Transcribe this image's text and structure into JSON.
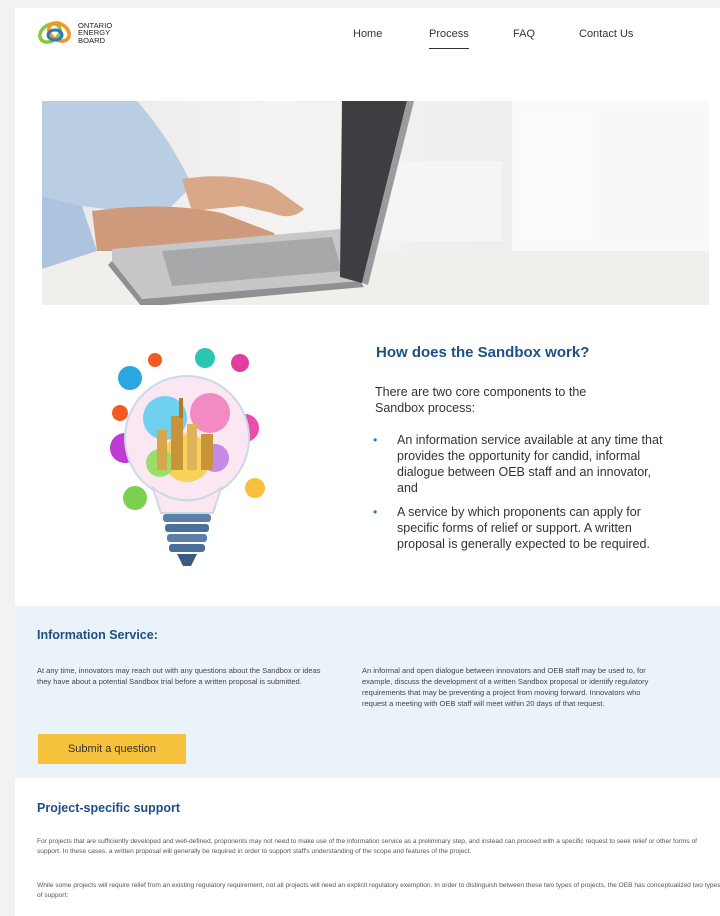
{
  "logo": {
    "lines": [
      "ONTARIO",
      "ENERGY",
      "BOARD"
    ],
    "icon": "oeb-logo-icon",
    "colors": {
      "green": "#8cc63f",
      "orange": "#f7941d",
      "blue": "#2a7ab8"
    }
  },
  "nav": {
    "items": [
      {
        "label": "Home",
        "active": false
      },
      {
        "label": "Process",
        "active": true
      },
      {
        "label": "FAQ",
        "active": false
      },
      {
        "label": "Contact Us",
        "active": false
      }
    ]
  },
  "hero": {
    "image": "hands-typing-on-laptop"
  },
  "how": {
    "illustration": "lightbulb-city-splash-illustration",
    "title": "How does the Sandbox work?",
    "intro": "There are two core components to the Sandbox process:",
    "bullets": [
      "An information service available at any time that provides the opportunity for candid, informal dialogue between OEB staff and an innovator, and",
      "A service by which proponents can apply for specific forms of relief or support. A written proposal is generally expected to be required."
    ]
  },
  "info": {
    "title": "Information Service:",
    "left_text": "At any time, innovators may reach out with any questions about the Sandbox or ideas they have about a potential Sandbox trial before a written proposal is submitted.",
    "right_text": "An informal and open dialogue between innovators and OEB staff may be used to, for example, discuss the development of a written Sandbox proposal or identify regulatory requirements that may be preventing a project from moving forward. Innovators who request a meeting with OEB staff will meet within 20 days of that request.",
    "button_label": "Submit a question",
    "button_color": "#f7c23b"
  },
  "project": {
    "title": "Project-specific support",
    "p1": "For projects that are sufficiently developed and well-defined, proponents may not need to make use of the information service as a preliminary step, and instead can proceed with a specific request to seek relief or other forms of support. In these cases, a written proposal will generally be required in order to support staff's understanding of the scope and features of the project.",
    "p2": "While some projects will require relief from an existing regulatory requirement, not all projects will need an explicit regulatory exemption. In order to distinguish between these two types of projects, the OEB has conceptualized two types of support:"
  },
  "theme": {
    "heading_color": "#1f4f82",
    "info_bg": "#eaf3f9"
  }
}
